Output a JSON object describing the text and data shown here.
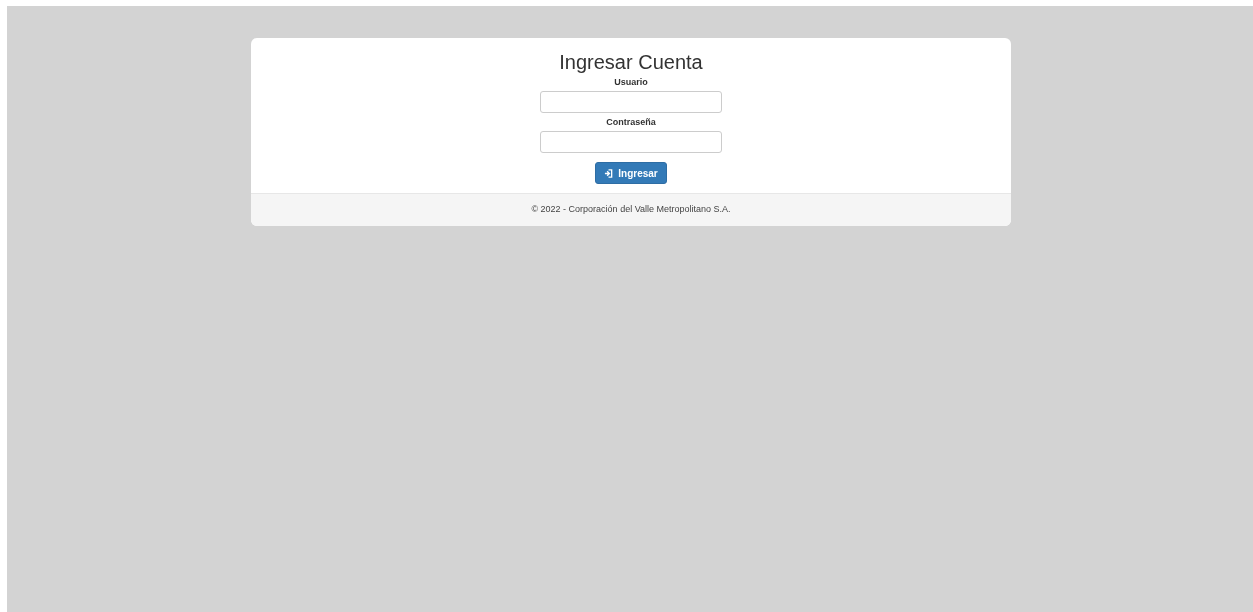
{
  "login": {
    "title": "Ingresar Cuenta",
    "fields": [
      {
        "label": "Usuario"
      },
      {
        "label": "Contraseña"
      }
    ],
    "submit": {
      "label": "Ingresar"
    }
  },
  "footer": {
    "text": "© 2022 - Corporación del Valle Metropolitano S.A."
  }
}
